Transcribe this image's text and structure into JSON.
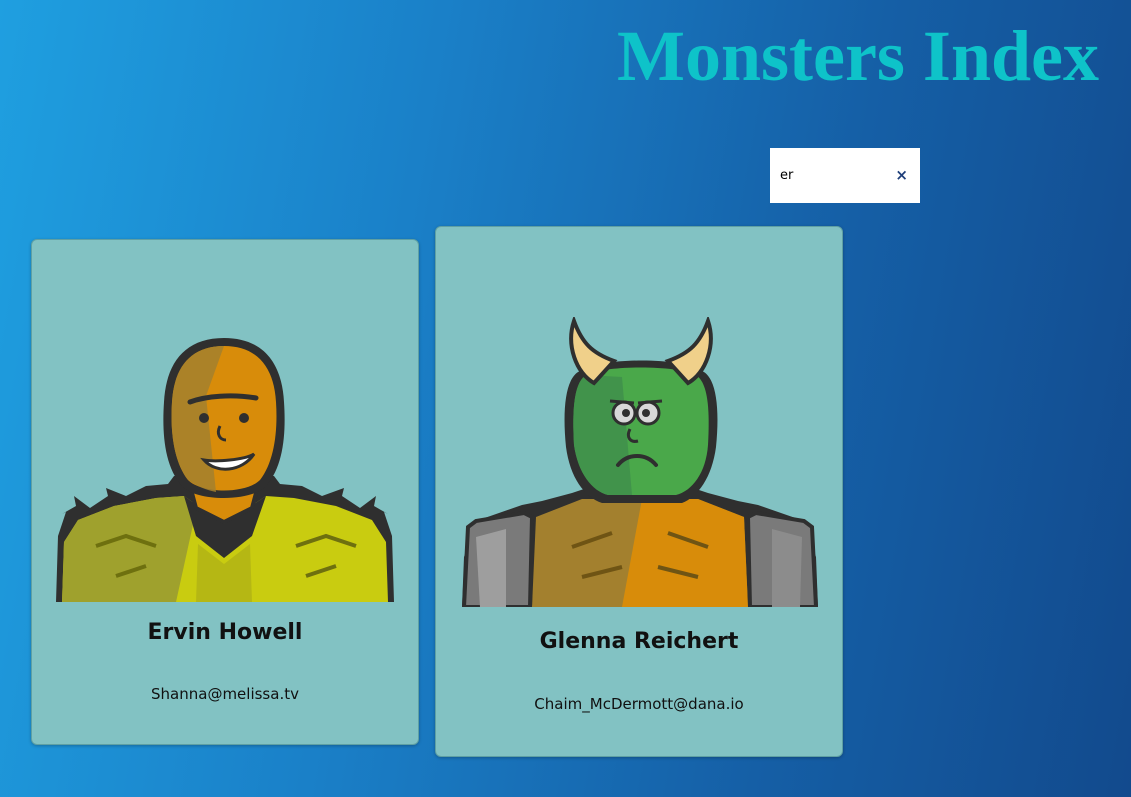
{
  "header": {
    "title": "Monsters Index"
  },
  "search": {
    "value": "er",
    "clear_glyph": "×"
  },
  "monsters": [
    {
      "name": "Ervin Howell",
      "email": "Shanna@melissa.tv",
      "avatar": "robot-avatar-icon"
    },
    {
      "name": "Glenna Reichert",
      "email": "Chaim_McDermott@dana.io",
      "avatar": "robot-avatar-icon"
    }
  ],
  "colors": {
    "title": "#0ec3c9",
    "card": "#82c2c3",
    "background": "#1a80c8"
  }
}
